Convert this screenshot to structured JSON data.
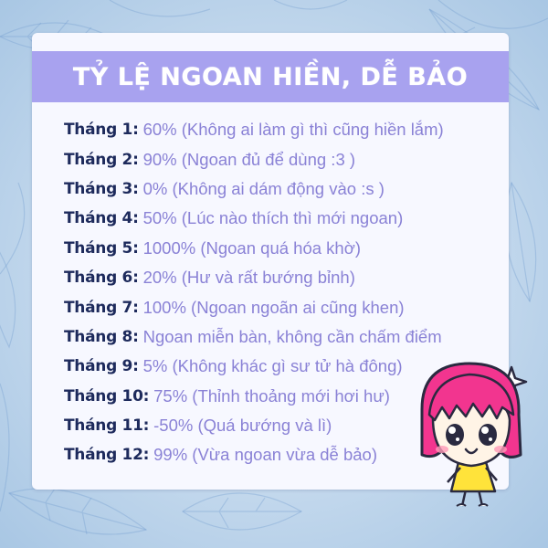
{
  "title": "TỶ LỆ NGOAN HIỀN, DỄ BẢO",
  "rows": [
    {
      "month": "Tháng 1:",
      "value": "60% (Không ai làm gì thì cũng hiền lắm)"
    },
    {
      "month": "Tháng 2:",
      "value": "90% (Ngoan đủ để dùng :3 )"
    },
    {
      "month": "Tháng 3:",
      "value": "0% (Không ai dám động vào :s )"
    },
    {
      "month": "Tháng 4:",
      "value": "50% (Lúc nào thích thì mới ngoan)"
    },
    {
      "month": "Tháng 5:",
      "value": "1000% (Ngoan quá hóa khờ)"
    },
    {
      "month": "Tháng 6:",
      "value": "20% (Hư và rất bướng bỉnh)"
    },
    {
      "month": "Tháng 7:",
      "value": "100% (Ngoan ngoãn ai cũng khen)"
    },
    {
      "month": "Tháng 8:",
      "value": "Ngoan miễn bàn, không cần chấm điểm"
    },
    {
      "month": "Tháng 9:",
      "value": "5% (Không khác gì sư tử hà đông)"
    },
    {
      "month": "Tháng 10:",
      "value": "75% (Thỉnh thoảng mới hơi hư)"
    },
    {
      "month": "Tháng 11:",
      "value": "-50% (Quá bướng và lì)"
    },
    {
      "month": "Tháng 12:",
      "value": "99% (Vừa ngoan vừa dễ bảo)"
    }
  ],
  "colors": {
    "banner": "#a8a2ef",
    "month_text": "#1d2a5c",
    "value_text": "#8a82d6",
    "background": "#c9dff0"
  },
  "illustration": "cartoon-girl-pink-hair"
}
